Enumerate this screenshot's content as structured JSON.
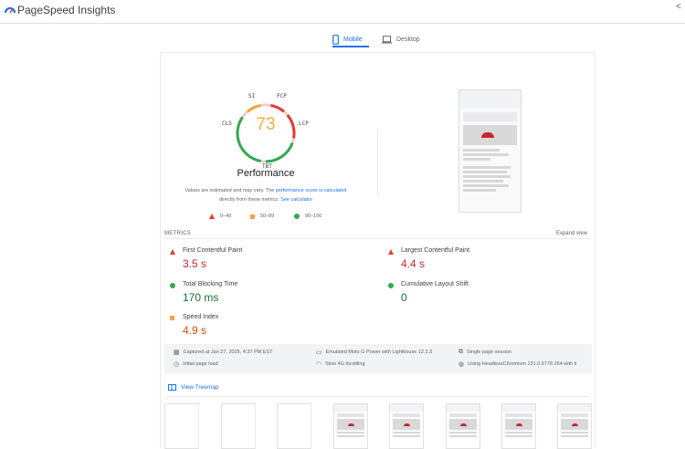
{
  "app": {
    "title": "PageSpeed Insights",
    "share_label": "<"
  },
  "tabs": [
    {
      "label": "Mobile",
      "icon": "phone-icon",
      "active": true
    },
    {
      "label": "Desktop",
      "icon": "laptop-icon",
      "active": false
    }
  ],
  "gauge": {
    "score": "73",
    "score_fraction": 0.73,
    "label": "Performance",
    "tags": {
      "si": "SI",
      "fcp": "FCP",
      "lcp": "LCP",
      "tbt": "TBT",
      "cls": "CLS"
    },
    "colors": {
      "score": "#e8b23e",
      "green": "#34a853",
      "orange": "#f4a340",
      "red": "#e53935",
      "track": "#f4cccc"
    }
  },
  "estimated": {
    "prefix": "Values are estimated and may vary. The",
    "link1": "performance score is calculated",
    "middle": "directly from these metrics.",
    "link2": "See calculator"
  },
  "legend": [
    {
      "shape": "triangle",
      "range": "0–49",
      "color": "#e53935"
    },
    {
      "shape": "square",
      "range": "50–89",
      "color": "#f4a340"
    },
    {
      "shape": "circle",
      "range": "90–100",
      "color": "#34a853"
    }
  ],
  "metrics": {
    "title": "METRICS",
    "expand_label": "Expand view",
    "items": [
      {
        "name": "First Contentful Paint",
        "value": "3.5 s",
        "status": "fail"
      },
      {
        "name": "Largest Contentful Paint",
        "value": "4.4 s",
        "status": "fail"
      },
      {
        "name": "Total Blocking Time",
        "value": "170 ms",
        "status": "pass"
      },
      {
        "name": "Cumulative Layout Shift",
        "value": "0",
        "status": "pass"
      },
      {
        "name": "Speed Index",
        "value": "4.9 s",
        "status": "average"
      }
    ]
  },
  "info": {
    "captured": "Captured at Jan 27, 2025, 4:37 PM EST",
    "initial_load": "Initial page load",
    "emulated": "Emulated Moto G Power with Lighthouse 12.2.3",
    "throttling": "Slow 4G throttling",
    "session": "Single page session",
    "browser": "Using HeadlessChromium 131.0.6778.264 with lr"
  },
  "treemap": {
    "label": "View Treemap"
  }
}
